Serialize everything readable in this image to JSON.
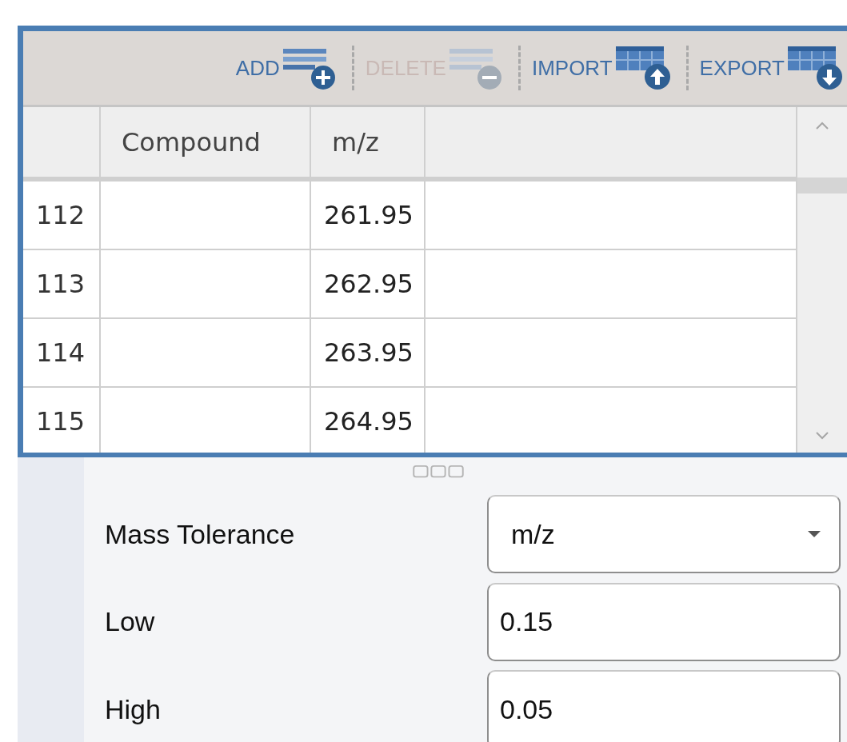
{
  "toolbar": [
    {
      "label": "ADD",
      "kind": "add",
      "disabled": false
    },
    {
      "label": "DELETE",
      "kind": "delete",
      "disabled": true
    },
    {
      "label": "IMPORT",
      "kind": "import",
      "disabled": false
    },
    {
      "label": "EXPORT",
      "kind": "export",
      "disabled": false
    }
  ],
  "table": {
    "columns": [
      "Compound",
      "m/z"
    ],
    "rows": [
      {
        "number": "112",
        "mz": "261.95"
      },
      {
        "number": "113",
        "mz": "262.95"
      },
      {
        "number": "114",
        "mz": "263.95"
      },
      {
        "number": "115",
        "mz": "264.95"
      }
    ]
  },
  "form": [
    {
      "label": "Mass Tolerance",
      "kind": "select",
      "value": "m/z"
    },
    {
      "label": "Low",
      "kind": "input",
      "value": "0.15"
    },
    {
      "label": "High",
      "kind": "input",
      "value": "0.05"
    }
  ]
}
